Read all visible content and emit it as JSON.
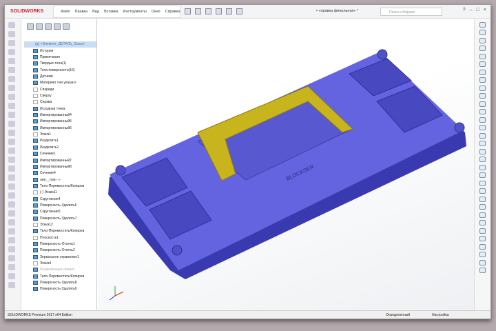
{
  "app": {
    "logo": "SOLIDWORKS",
    "document_title": "• «правка финальная» *"
  },
  "menu": [
    "Файл",
    "Правка",
    "Вид",
    "Вставка",
    "Инструменты",
    "Окно",
    "Справка"
  ],
  "search": {
    "placeholder": "Поиск в Форуме"
  },
  "tree": {
    "root": "(д) <Элемент_ДЕТАЛЬ_Эскиз>",
    "items": [
      {
        "label": "История",
        "icon": "folder"
      },
      {
        "label": "Примечания",
        "icon": "folder"
      },
      {
        "label": "Твердые тела(1)",
        "icon": "folder"
      },
      {
        "label": "Тела поверхности(16)",
        "icon": "folder"
      },
      {
        "label": "Датчики",
        "icon": "folder"
      },
      {
        "label": "Материал <не указан>",
        "icon": "material"
      },
      {
        "label": "Спереди",
        "icon": "plane"
      },
      {
        "label": "Сверху",
        "icon": "plane"
      },
      {
        "label": "Справа",
        "icon": "plane"
      },
      {
        "label": "Исходная точка",
        "icon": "origin"
      },
      {
        "label": "Импортированный4",
        "icon": "feature"
      },
      {
        "label": "Импортированный5",
        "icon": "feature"
      },
      {
        "label": "Импортированный6",
        "icon": "feature"
      },
      {
        "label": "Эскиз1",
        "icon": "sketch"
      },
      {
        "label": "Разделить1",
        "icon": "feature"
      },
      {
        "label": "Разделить2",
        "icon": "feature"
      },
      {
        "label": "Сечение1",
        "icon": "feature"
      },
      {
        "label": "Импортированный7",
        "icon": "feature"
      },
      {
        "label": "Импортированный8",
        "icon": "feature"
      },
      {
        "label": "Сечение4",
        "icon": "feature"
      },
      {
        "label": "лин__пов-- »",
        "icon": "folder"
      },
      {
        "label": "Тело-Переместить/Копиров",
        "icon": "feature"
      },
      {
        "label": "(-) Эскиз11",
        "icon": "sketch"
      },
      {
        "label": "Скругление4",
        "icon": "feature"
      },
      {
        "label": "Поверхность-Удалить6",
        "icon": "feature"
      },
      {
        "label": "Скругление5",
        "icon": "feature"
      },
      {
        "label": "Поверхность-Удалить7",
        "icon": "feature"
      },
      {
        "label": "Эскиз12",
        "icon": "sketch"
      },
      {
        "label": "Тело-Переместить/Копиров",
        "icon": "feature"
      },
      {
        "label": "Плоскость1",
        "icon": "plane"
      },
      {
        "label": "Поверхность-Отсечь1",
        "icon": "feature"
      },
      {
        "label": "Поверхность-Отсечь2",
        "icon": "feature"
      },
      {
        "label": "Зеркальное отражение1",
        "icon": "feature"
      },
      {
        "label": "Эскиз4",
        "icon": "sketch"
      },
      {
        "label": "Разделяющие линии1",
        "icon": "folder",
        "dim": true
      },
      {
        "label": "Тело-Переместить/Копиров",
        "icon": "feature"
      },
      {
        "label": "Поверхность-Удалить8",
        "icon": "feature"
      },
      {
        "label": "Поверхность-Удалить9",
        "icon": "feature"
      }
    ]
  },
  "status": {
    "edition": "SOLIDWORKS Premium 2017 x64 Edition",
    "state": "Определенный",
    "settings": "Настройка"
  },
  "colors": {
    "part": "#5a5ad8",
    "handle": "#c8b41c"
  }
}
